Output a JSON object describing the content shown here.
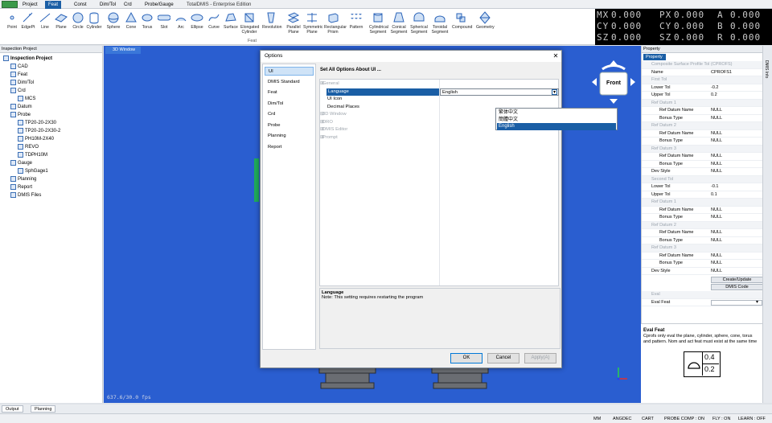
{
  "menubar": {
    "app_icon": "app-logo-icon",
    "items": [
      "Project",
      "Feat",
      "Const",
      "Dim/Tol",
      "Crd",
      "Probe/Gauge"
    ],
    "active": "Feat",
    "title": "TotalDMIS - Enterprise Edition"
  },
  "ribbon": {
    "group_label": "Feat",
    "tools": [
      "Point",
      "EdgePt",
      "Line",
      "Plane",
      "Circle",
      "Cylinder",
      "Sphere",
      "Cone",
      "Torus",
      "Slot",
      "Arc",
      "Ellipse",
      "Curve",
      "Surface",
      "Elongated Cylinder",
      "Revolution",
      "Parallel Plane",
      "Symmetric Plane",
      "Rectangular Prism",
      "Pattern",
      "Cylindrical Segment",
      "Conical Segment",
      "Spherical Segment",
      "Toroidal Segment",
      "Compound",
      "Geometry"
    ]
  },
  "dro": {
    "rows": [
      {
        "l1": "MX",
        "v1": "0.000",
        "l2": "PX",
        "v2": "0.000",
        "l3": "A",
        "v3": "0.000"
      },
      {
        "l1": "CY",
        "v1": "0.000",
        "l2": "CY",
        "v2": "0.000",
        "l3": "B",
        "v3": "0.000"
      },
      {
        "l1": "SZ",
        "v1": "0.000",
        "l2": "SZ",
        "v2": "0.000",
        "l3": "R",
        "v3": "0.000"
      }
    ]
  },
  "left_panel": {
    "title": "Inspection Project",
    "tree": [
      {
        "label": "Inspection Project",
        "level": 0,
        "bold": true
      },
      {
        "label": "CAD",
        "level": 1
      },
      {
        "label": "Feat",
        "level": 1
      },
      {
        "label": "Dim/Tol",
        "level": 1
      },
      {
        "label": "Crd",
        "level": 1
      },
      {
        "label": "MCS",
        "level": 2
      },
      {
        "label": "Datum",
        "level": 1
      },
      {
        "label": "Probe",
        "level": 1
      },
      {
        "label": "TP20-20-2X30",
        "level": 2
      },
      {
        "label": "TP20-20-2X30-2",
        "level": 2
      },
      {
        "label": "PH10M-2X40",
        "level": 2
      },
      {
        "label": "REVO",
        "level": 2
      },
      {
        "label": "TDPH10M",
        "level": 2
      },
      {
        "label": "Gauge",
        "level": 1
      },
      {
        "label": "SphGage1",
        "level": 2
      },
      {
        "label": "Planning",
        "level": 1
      },
      {
        "label": "Report",
        "level": 1
      },
      {
        "label": "DMIS Files",
        "level": 1
      }
    ]
  },
  "view": {
    "tab_label": "3D Window",
    "fps": "637.6/30.0 fps",
    "cube_label": "Front"
  },
  "dialog": {
    "title": "Options",
    "nav": [
      "UI",
      "DMIS Standard",
      "Feat",
      "Dim/Tol",
      "Crd",
      "Probe",
      "Planning",
      "Report"
    ],
    "selected_nav": "UI",
    "heading": "Set All Options About UI ...",
    "grid": [
      {
        "type": "cat",
        "label": "General"
      },
      {
        "type": "row",
        "label": "Language",
        "value": "English",
        "selected": true
      },
      {
        "type": "row",
        "label": "UI Icon",
        "value": ""
      },
      {
        "type": "row",
        "label": "Decimal Places",
        "value": ""
      },
      {
        "type": "cat",
        "label": "3D Window"
      },
      {
        "type": "cat",
        "label": "DRO"
      },
      {
        "type": "cat",
        "label": "DMIS Editor"
      },
      {
        "type": "cat",
        "label": "Prompt"
      }
    ],
    "dropdown_options": [
      "繁体中文",
      "簡體中文",
      "English"
    ],
    "dropdown_selected": "English",
    "desc_title": "Language",
    "desc_text": "Note: This setting requires restarting the program",
    "buttons": {
      "ok": "OK",
      "cancel": "Cancel",
      "apply": "Apply(A)"
    }
  },
  "right_panel": {
    "title": "Property",
    "tab": "Property",
    "side_tab": "DMIS Info",
    "rows": [
      {
        "t": "group",
        "k": "Composite Surface Profile Tol (CPROFS)"
      },
      {
        "t": "row",
        "k": "Name",
        "v": "CPROFS1"
      },
      {
        "t": "group",
        "k": "First Tol"
      },
      {
        "t": "row",
        "k": "Lower Tol",
        "v": "-0.2"
      },
      {
        "t": "row",
        "k": "Upper Tol",
        "v": "0.2"
      },
      {
        "t": "group",
        "k": "Ref Datum 1"
      },
      {
        "t": "sub",
        "k": "Ref Datum Name",
        "v": "NULL"
      },
      {
        "t": "sub",
        "k": "Bonus Type",
        "v": "NULL"
      },
      {
        "t": "group",
        "k": "Ref Datum 2"
      },
      {
        "t": "sub",
        "k": "Ref Datum Name",
        "v": "NULL"
      },
      {
        "t": "sub",
        "k": "Bonus Type",
        "v": "NULL"
      },
      {
        "t": "group",
        "k": "Ref Datum 3"
      },
      {
        "t": "sub",
        "k": "Ref Datum Name",
        "v": "NULL"
      },
      {
        "t": "sub",
        "k": "Bonus Type",
        "v": "NULL"
      },
      {
        "t": "row",
        "k": "Dev Style",
        "v": "NULL"
      },
      {
        "t": "group",
        "k": "Second Tol"
      },
      {
        "t": "row",
        "k": "Lower Tol",
        "v": "-0.1"
      },
      {
        "t": "row",
        "k": "Upper Tol",
        "v": "0.1"
      },
      {
        "t": "group",
        "k": "Ref Datum 1"
      },
      {
        "t": "sub",
        "k": "Ref Datum Name",
        "v": "NULL"
      },
      {
        "t": "sub",
        "k": "Bonus Type",
        "v": "NULL"
      },
      {
        "t": "group",
        "k": "Ref Datum 2"
      },
      {
        "t": "sub",
        "k": "Ref Datum Name",
        "v": "NULL"
      },
      {
        "t": "sub",
        "k": "Bonus Type",
        "v": "NULL"
      },
      {
        "t": "group",
        "k": "Ref Datum 3"
      },
      {
        "t": "sub",
        "k": "Ref Datum Name",
        "v": "NULL"
      },
      {
        "t": "sub",
        "k": "Bonus Type",
        "v": "NULL"
      },
      {
        "t": "row",
        "k": "Dev Style",
        "v": "NULL"
      }
    ],
    "create_update": "Create/Update",
    "dmis_code": "DMIS Code",
    "eval_group": "Eval",
    "eval_feat_label": "Eval Feat",
    "help_title": "Eval Feat",
    "help_text": "Cprofs only eval the plane, cylinder, sphere, cone, torus and pattern. Nom and act feat must exist at the same time",
    "symbol_top": "0.4",
    "symbol_bottom": "0.2"
  },
  "bottom_tabs": [
    "Output",
    "Planning"
  ],
  "status": [
    "MM",
    "ANGDEC",
    "CART",
    "PROBE COMP : ON",
    "FLY : ON",
    "LEARN : OFF"
  ],
  "colors": {
    "accent": "#1a5ea5",
    "view_bg": "#2a5ed0",
    "green_handle": "#1faa5c"
  }
}
